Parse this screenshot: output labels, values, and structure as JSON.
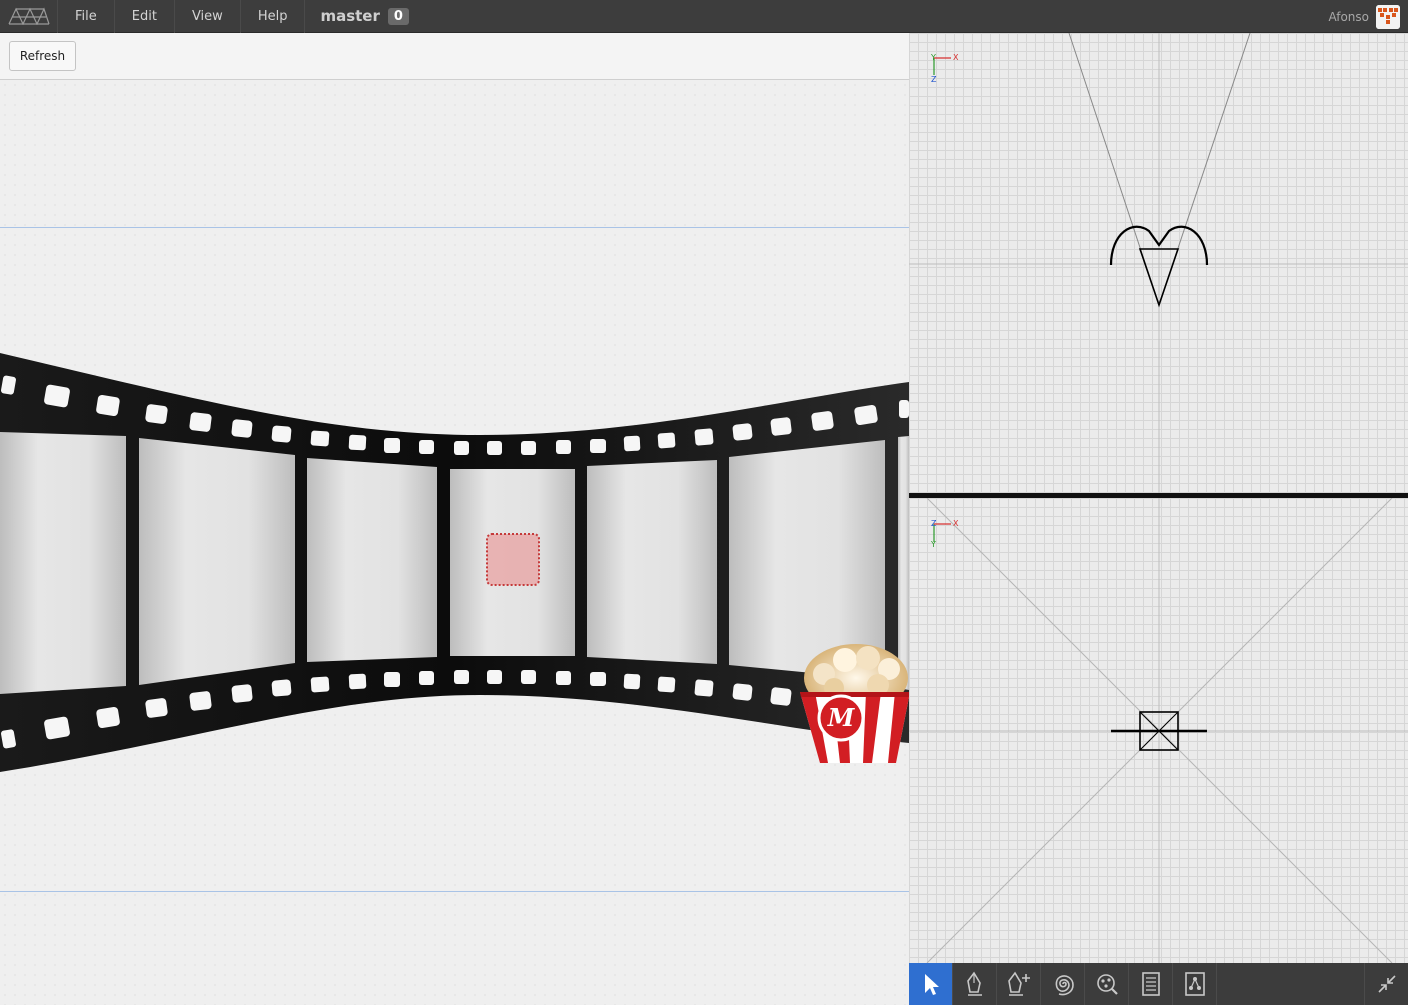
{
  "menu": {
    "items": [
      "File",
      "Edit",
      "View",
      "Help"
    ],
    "branch_name": "master",
    "branch_count": "0"
  },
  "user": {
    "name": "Afonso"
  },
  "toolbar": {
    "refresh_label": "Refresh"
  },
  "viewports": {
    "top": {
      "axis_h": "X",
      "axis_v1": "Y",
      "axis_v2": "Z"
    },
    "bottom": {
      "axis_h": "X",
      "axis_v1": "Z",
      "axis_v2": "Y"
    }
  },
  "tools": [
    "pointer-icon",
    "pen-icon",
    "pen-add-icon",
    "spiral-icon",
    "network-icon",
    "document-icon",
    "hierarchy-icon",
    "collapse-icon"
  ],
  "colors": {
    "active_tool": "#2f6fd0",
    "topbar": "#3d3d3d",
    "selection": "#e89a9a"
  }
}
